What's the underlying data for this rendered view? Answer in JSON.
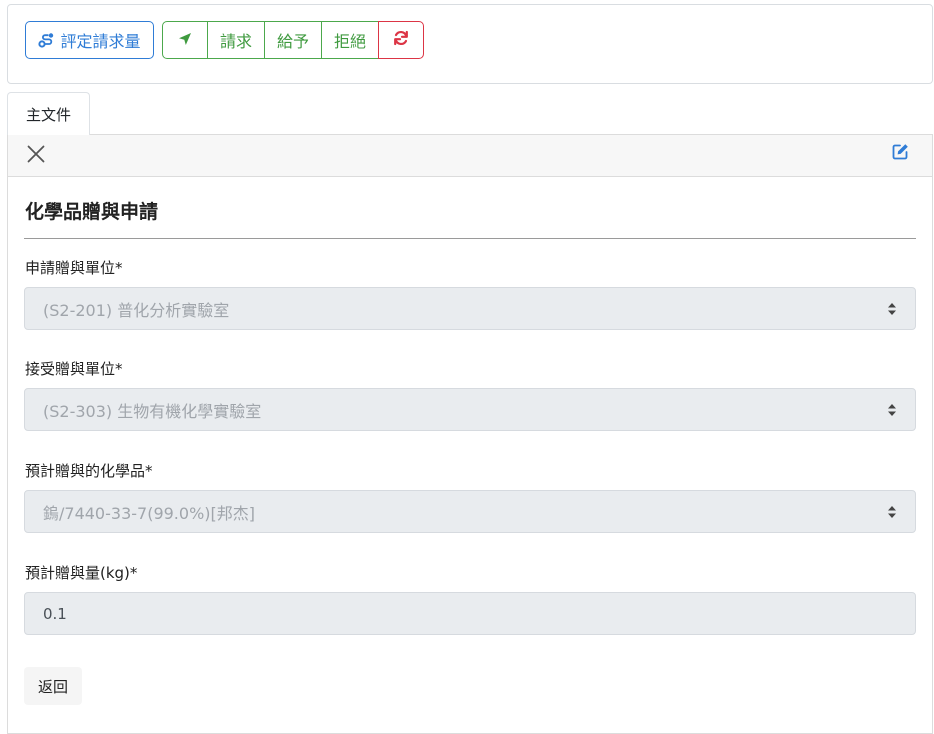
{
  "toolbar": {
    "assess_label": "評定請求量",
    "request_label": "請求",
    "give_label": "給予",
    "reject_label": "拒絕",
    "colors": {
      "primary": "#2f7cd6",
      "success": "#4ca84c",
      "danger": "#dc3545"
    }
  },
  "tabs": [
    {
      "label": "主文件"
    }
  ],
  "form": {
    "title": "化學品贈與申請",
    "fields": [
      {
        "label": "申請贈與單位*",
        "value": "(S2-201) 普化分析實驗室"
      },
      {
        "label": "接受贈與單位*",
        "value": "(S2-303) 生物有機化學實驗室"
      },
      {
        "label": "預計贈與的化學品*",
        "value": "鎢/7440-33-7(99.0%)[邦杰]"
      },
      {
        "label": "預計贈與量(kg)*",
        "value": "0.1"
      }
    ],
    "back_label": "返回"
  }
}
